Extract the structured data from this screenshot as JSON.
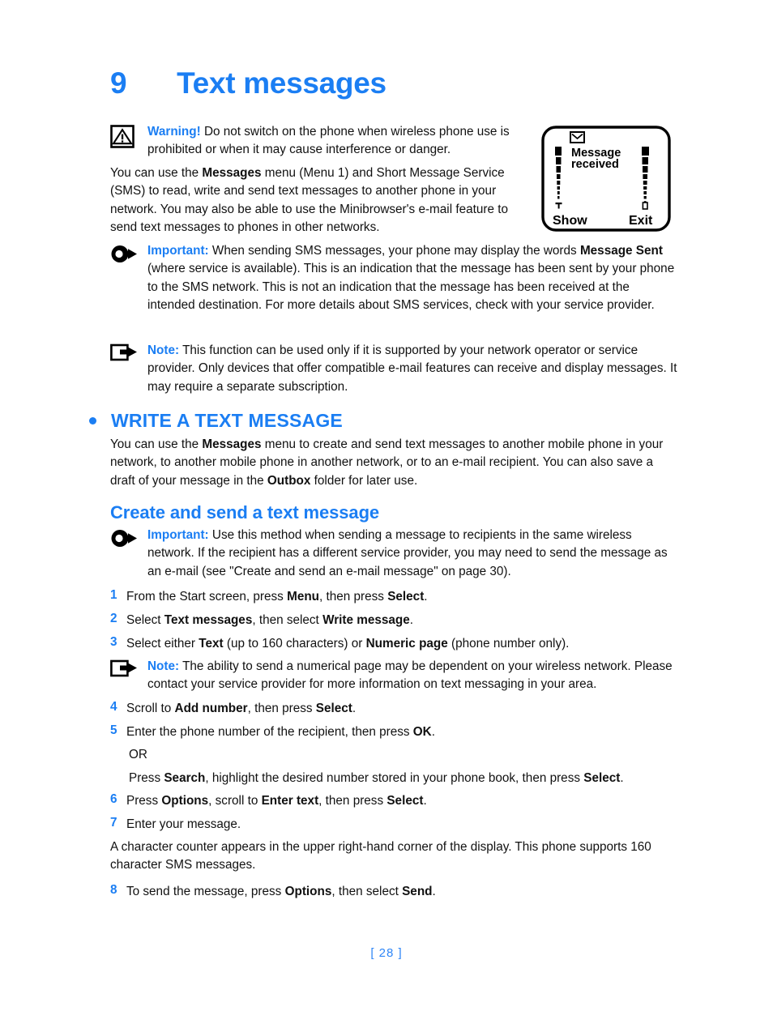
{
  "chapter": {
    "number": "9",
    "title": "Text messages"
  },
  "warning": {
    "icon": "warning-triangle-icon",
    "label": "Warning!",
    "text": " Do not switch on the phone when wireless phone use is prohibited or when it may cause interference or danger."
  },
  "intro_paragraph": {
    "seg1": "You can use the ",
    "bold1": "Messages",
    "seg2": " menu (Menu 1) and Short Message Service (SMS) to read, write and send text messages to another phone in your network. You may also be able to use the Minibrowser's e-mail feature to send text messages to phones in other networks."
  },
  "important_sms": {
    "icon": "important-arrow-icon",
    "label": "Important:",
    "seg1": " When sending SMS messages, your phone may display the words ",
    "bold1": "Message Sent",
    "seg2": " (where service is available). This is an indication that the message has been sent by your phone to the SMS network. This is not an indication that the message has been received at the intended destination. For more details about SMS services, check with your service provider."
  },
  "note_function": {
    "icon": "note-arrow-icon",
    "label": "Note:",
    "text": " This function can be used only if it is supported by your network operator or service provider. Only devices that offer compatible e-mail features can receive and display messages. It may require a separate subscription."
  },
  "section": {
    "bullet": "section-bullet",
    "heading": "WRITE A TEXT MESSAGE",
    "paragraph": {
      "seg1": "You can use the ",
      "bold1": "Messages",
      "seg2": " menu to create and send text messages to another mobile phone in your network, to another mobile phone in another network, or to an e-mail recipient. You can also save a draft of your message in the ",
      "bold2": "Outbox",
      "seg3": " folder for later use."
    }
  },
  "subsection": {
    "heading": "Create and send a text message",
    "important": {
      "icon": "important-arrow-icon",
      "label": "Important:",
      "text": " Use this method when sending a message to recipients in the same wireless network. If the recipient has a different service provider, you may need to send the message as an e-mail (see \"Create and send an e-mail message\" on page 30)."
    }
  },
  "steps": [
    {
      "num": "1",
      "seg1": "From the Start screen, press ",
      "bold1": "Menu",
      "seg2": ", then press ",
      "bold2": "Select",
      "seg3": "."
    },
    {
      "num": "2",
      "seg1": "Select ",
      "bold1": "Text messages",
      "seg2": ", then select ",
      "bold2": "Write message",
      "seg3": "."
    },
    {
      "num": "3",
      "seg1": "Select either ",
      "bold1": "Text",
      "seg2": " (up to 160 characters) or ",
      "bold2": "Numeric page",
      "seg3": " (phone number only)."
    },
    {
      "num": "4",
      "seg1": "Scroll to ",
      "bold1": "Add number",
      "seg2": ", then press ",
      "bold2": "Select",
      "seg3": "."
    },
    {
      "num": "5",
      "seg1": "Enter the phone number of the recipient, then press ",
      "bold1": "OK",
      "seg2": ".",
      "bold2": "",
      "seg3": ""
    },
    {
      "num": "6",
      "seg1": "Press ",
      "bold1": "Options",
      "seg2": ", scroll to ",
      "bold2": "Enter text",
      "seg3": ", then press ",
      "bold3": "Select",
      "seg4": "."
    },
    {
      "num": "7",
      "seg1": "Enter your message.",
      "bold1": "",
      "seg2": "",
      "bold2": "",
      "seg3": ""
    },
    {
      "num": "8",
      "seg1": "To send the message, press ",
      "bold1": "Options",
      "seg2": ", then select ",
      "bold2": "Send",
      "seg3": "."
    }
  ],
  "note_numeric": {
    "icon": "note-arrow-icon",
    "label": "Note:",
    "text": " The ability to send a numerical page may be dependent on your wireless network. Please contact your service provider for more information on text messaging in your area."
  },
  "or_text": "OR",
  "search_line": {
    "seg1": "Press ",
    "bold1": "Search",
    "seg2": ", highlight the desired number stored in your phone book, then press ",
    "bold2": "Select",
    "seg3": "."
  },
  "counter_paragraph": "A character counter appears in the upper right-hand corner of the display. This phone supports 160 character SMS messages.",
  "phone_screen": {
    "envelope_icon": "envelope-icon",
    "message_line1": "Message",
    "message_line2": "received",
    "softkey_left": "Show",
    "softkey_right": "Exit",
    "signal_icon": "antenna-icon",
    "battery_icon": "battery-icon"
  },
  "footer": {
    "page_number": "[ 28 ]"
  },
  "colors": {
    "accent_blue": "#1b7ef3",
    "body_text": "#111111",
    "page_background": "#ffffff"
  }
}
